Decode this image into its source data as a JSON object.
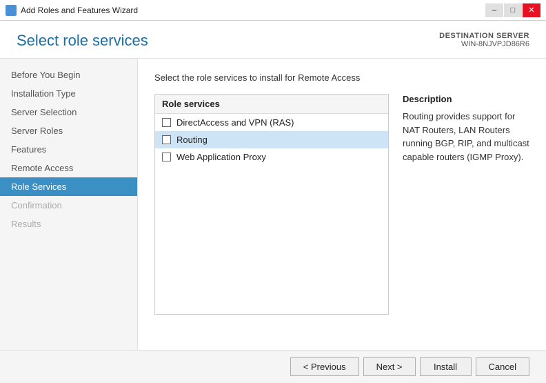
{
  "window": {
    "title": "Add Roles and Features Wizard",
    "icon": "wizard-icon"
  },
  "title_bar_controls": {
    "minimize": "–",
    "maximize": "□",
    "close": "✕"
  },
  "header": {
    "title": "Select role services",
    "destination_label": "DESTINATION SERVER",
    "server_name": "WIN-8NJVPJD86R6"
  },
  "nav": {
    "items": [
      {
        "label": "Before You Begin",
        "state": "normal"
      },
      {
        "label": "Installation Type",
        "state": "normal"
      },
      {
        "label": "Server Selection",
        "state": "normal"
      },
      {
        "label": "Server Roles",
        "state": "normal"
      },
      {
        "label": "Features",
        "state": "normal"
      },
      {
        "label": "Remote Access",
        "state": "normal"
      },
      {
        "label": "Role Services",
        "state": "active"
      },
      {
        "label": "Confirmation",
        "state": "disabled"
      },
      {
        "label": "Results",
        "state": "disabled"
      }
    ]
  },
  "content": {
    "instruction": "Select the role services to install for Remote Access",
    "role_services": {
      "header": "Role services",
      "items": [
        {
          "label": "DirectAccess and VPN (RAS)",
          "checked": false,
          "selected": false
        },
        {
          "label": "Routing",
          "checked": false,
          "selected": true
        },
        {
          "label": "Web Application Proxy",
          "checked": false,
          "selected": false
        }
      ]
    },
    "description": {
      "title": "Description",
      "text": "Routing provides support for NAT Routers, LAN Routers running BGP, RIP, and multicast capable routers (IGMP Proxy)."
    }
  },
  "footer": {
    "previous_label": "< Previous",
    "next_label": "Next >",
    "install_label": "Install",
    "cancel_label": "Cancel"
  }
}
